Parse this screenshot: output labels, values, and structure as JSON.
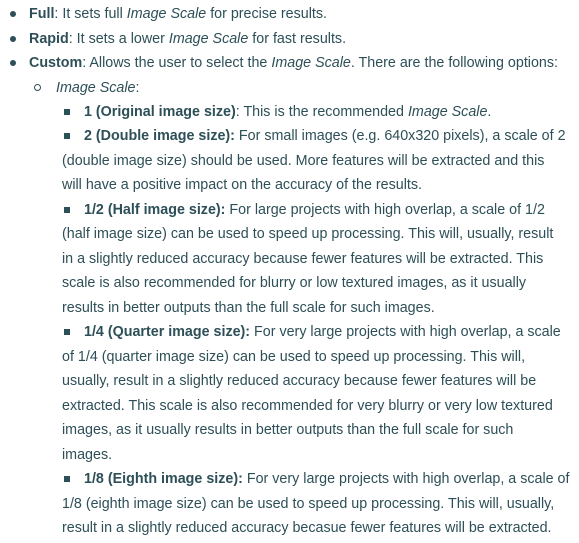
{
  "items": {
    "full": {
      "label": "Full",
      "t1": ": It sets full ",
      "em": "Image Scale",
      "t2": " for precise results."
    },
    "rapid": {
      "label": "Rapid",
      "t1": ": It sets a lower ",
      "em": "Image Scale",
      "t2": " for fast results."
    },
    "custom": {
      "label": "Custom",
      "t1": ": Allows the user to select the ",
      "em": "Image Scale",
      "t2": ". There are the following options:"
    }
  },
  "image_scale": {
    "label": "Image Scale",
    "colon": ":"
  },
  "options": {
    "o1": {
      "label": "1 (Original image size)",
      "t1": ": This is the recommended ",
      "em": "Image Scale",
      "t2": "."
    },
    "o2": {
      "label": "2 (Double image size):",
      "lines": [
        " For small images (e.g. 640x320 pixels), a scale of 2",
        "(double image size) should be used. More features will be extracted and this",
        "will have a positive impact on the accuracy of the results."
      ]
    },
    "o3": {
      "label": "1/2 (Half image size):",
      "lines": [
        " For large projects with high overlap, a scale of 1/2",
        "(half image size) can be used to speed up processing. This will, usually, result",
        "in a slightly reduced accuracy because fewer features will be extracted. This",
        "scale is also recommended for blurry or low textured images, as it usually",
        "results in better outputs than the full scale for such images."
      ]
    },
    "o4": {
      "label": "1/4 (Quarter image size):",
      "lines": [
        " For very large projects with high overlap, a scale",
        "of 1/4 (quarter image size) can be used to speed up processing. This will,",
        "usually, result in a slightly reduced accuracy because fewer features will be",
        "extracted. This scale is also recommended for very blurry or very low textured",
        "images, as it usually results in better outputs than the full scale for such",
        "images."
      ]
    },
    "o5": {
      "label": "1/8 (Eighth image size):",
      "lines": [
        " For very large projects with high overlap, a scale of",
        "1/8 (eighth image size) can be used to speed up processing. This will, usually,",
        "result in a slightly reduced accuracy becasue fewer features will be extracted."
      ]
    }
  }
}
